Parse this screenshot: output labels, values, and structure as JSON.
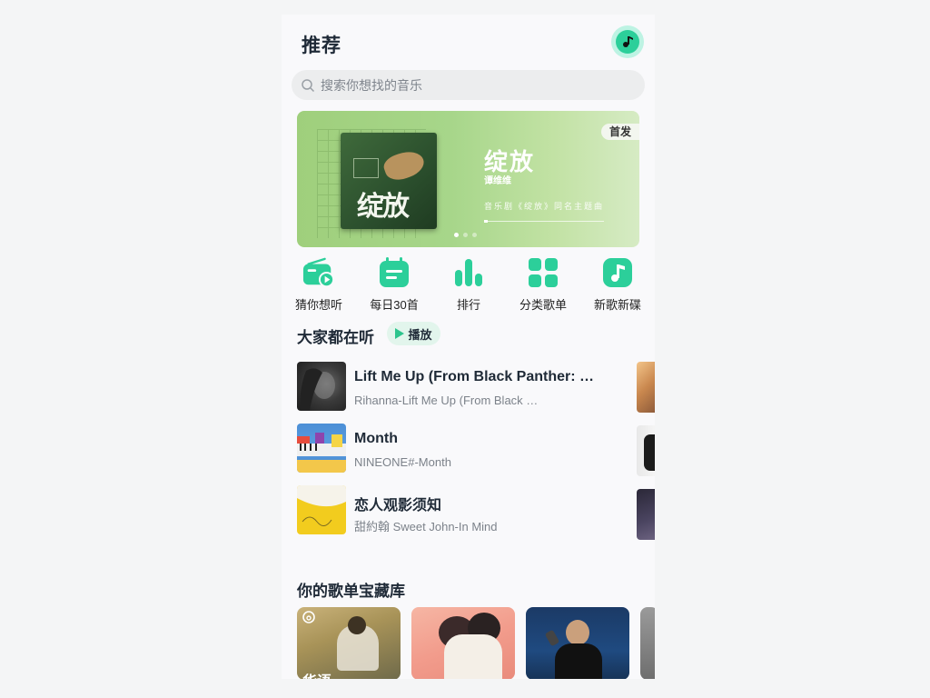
{
  "header": {
    "title": "推荐"
  },
  "search": {
    "placeholder": "搜索你想找的音乐"
  },
  "banner": {
    "title": "绽放",
    "artist": "谭维维",
    "description": "音乐剧《绽放》同名主题曲",
    "badge": "首发",
    "cover_text": "绽放"
  },
  "quick_actions": [
    {
      "label": "猜你想听",
      "icon": "radio-icon"
    },
    {
      "label": "每日30首",
      "icon": "calendar-icon"
    },
    {
      "label": "排行",
      "icon": "chart-bars-icon"
    },
    {
      "label": "分类歌单",
      "icon": "grid-icon"
    },
    {
      "label": "新歌新碟",
      "icon": "music-note-icon"
    }
  ],
  "popular": {
    "title": "大家都在听",
    "play_label": "播放",
    "songs": [
      {
        "title": "Lift Me Up (From Black Panther: Wakanda Forever)",
        "subtitle": "Rihanna-Lift Me Up (From Black Panther: Wakanda Forever)"
      },
      {
        "title": "Month",
        "subtitle": "NINEONE#-Month"
      },
      {
        "title": "恋人观影须知",
        "subtitle": "甜約翰 Sweet John-In Mind"
      }
    ]
  },
  "library": {
    "title": "你的歌单宝藏库",
    "first_card_text": "华语"
  },
  "colors": {
    "accent": "#2ccf9a",
    "text": "#1f2a37",
    "muted": "#7c828a"
  }
}
